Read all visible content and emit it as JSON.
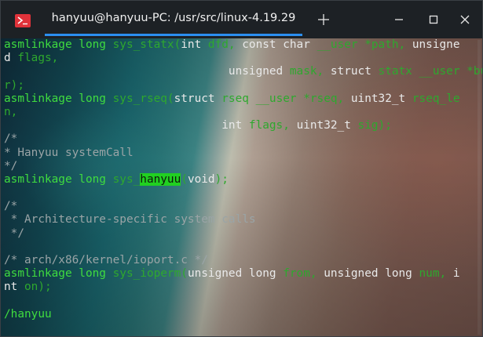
{
  "window": {
    "tab_title": "hanyuu@hanyuu-PC: /usr/src/linux-4.19.29",
    "icons": {
      "app": "terminal-icon",
      "new_tab": "plus-icon",
      "minimize": "minimize-icon",
      "maximize": "maximize-icon",
      "close": "close-icon"
    },
    "accent": "#2b8ff0"
  },
  "terminal": {
    "colors": {
      "keyword": "#3fdc3f",
      "text": "#e9e9e9",
      "dim": "#2ea82e",
      "comment": "#9aa4a6",
      "highlight": "#21d021"
    },
    "lines": [
      [
        {
          "t": "asmlinkage long ",
          "c": "kw"
        },
        {
          "t": "sys_statx(",
          "c": "dim"
        },
        {
          "t": "int ",
          "c": "plain"
        },
        {
          "t": "dfd, ",
          "c": "dim"
        },
        {
          "t": "const char ",
          "c": "plain"
        },
        {
          "t": "__user *path, ",
          "c": "dim"
        },
        {
          "t": "unsigne",
          "c": "plain"
        }
      ],
      [
        {
          "t": "d ",
          "c": "plain"
        },
        {
          "t": "flags,",
          "c": "dim"
        }
      ],
      [
        {
          "t": "                                 unsigned ",
          "c": "plain"
        },
        {
          "t": "mask, ",
          "c": "dim"
        },
        {
          "t": "struct ",
          "c": "plain"
        },
        {
          "t": "statx __user *buffe",
          "c": "dim"
        }
      ],
      [
        {
          "t": "r);",
          "c": "dim"
        }
      ],
      [
        {
          "t": "asmlinkage long ",
          "c": "kw"
        },
        {
          "t": "sys_rseq(",
          "c": "dim"
        },
        {
          "t": "struct ",
          "c": "plain"
        },
        {
          "t": "rseq __user *rseq, ",
          "c": "dim"
        },
        {
          "t": "uint32_t ",
          "c": "plain"
        },
        {
          "t": "rseq_le",
          "c": "dim"
        }
      ],
      [
        {
          "t": "n,",
          "c": "dim"
        }
      ],
      [
        {
          "t": "                                ",
          "c": "plain"
        },
        {
          "t": "int ",
          "c": "plain"
        },
        {
          "t": "flags, ",
          "c": "dim"
        },
        {
          "t": "uint32_t ",
          "c": "plain"
        },
        {
          "t": "sig);",
          "c": "dim"
        }
      ],
      [
        {
          "t": "/*",
          "c": "comment"
        }
      ],
      [
        {
          "t": "* Hanyuu systemCall",
          "c": "comment"
        }
      ],
      [
        {
          "t": "*/",
          "c": "comment"
        }
      ],
      [
        {
          "t": "asmlinkage long ",
          "c": "kw"
        },
        {
          "t": "sys_",
          "c": "dim"
        },
        {
          "t": "hanyuu",
          "c": "hl"
        },
        {
          "t": "(",
          "c": "dim"
        },
        {
          "t": "void",
          "c": "plain"
        },
        {
          "t": ");",
          "c": "dim"
        }
      ],
      [
        {
          "t": "",
          "c": "plain"
        }
      ],
      [
        {
          "t": "/*",
          "c": "comment"
        }
      ],
      [
        {
          "t": " * Architecture-specific system calls",
          "c": "comment"
        }
      ],
      [
        {
          "t": " */",
          "c": "comment"
        }
      ],
      [
        {
          "t": "",
          "c": "plain"
        }
      ],
      [
        {
          "t": "/* arch/x86/kernel/ioport.c */",
          "c": "comment"
        }
      ],
      [
        {
          "t": "asmlinkage long ",
          "c": "kw"
        },
        {
          "t": "sys_ioperm(",
          "c": "dim"
        },
        {
          "t": "unsigned long ",
          "c": "plain"
        },
        {
          "t": "from, ",
          "c": "dim"
        },
        {
          "t": "unsigned long ",
          "c": "plain"
        },
        {
          "t": "num, ",
          "c": "dim"
        },
        {
          "t": "i",
          "c": "plain"
        }
      ],
      [
        {
          "t": "nt ",
          "c": "plain"
        },
        {
          "t": "on);",
          "c": "dim"
        }
      ],
      [
        {
          "t": "",
          "c": "plain"
        }
      ],
      [
        {
          "t": "/hanyuu",
          "c": "kw"
        }
      ]
    ]
  }
}
